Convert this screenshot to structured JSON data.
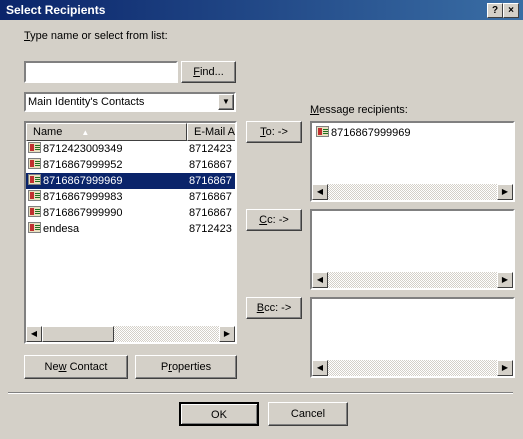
{
  "window": {
    "title": "Select Recipients",
    "help_label": "?",
    "close_label": "×"
  },
  "search": {
    "label": "Type name or select from list:",
    "value": "",
    "find_label": "Find..."
  },
  "source": {
    "selected": "Main Identity's Contacts"
  },
  "contacts": {
    "columns": [
      "Name",
      "E-Mail A"
    ],
    "rows": [
      {
        "name": "8712423009349",
        "email": "8712423"
      },
      {
        "name": "8716867999952",
        "email": "8716867"
      },
      {
        "name": "8716867999969",
        "email": "8716867",
        "selected": true
      },
      {
        "name": "8716867999983",
        "email": "8716867"
      },
      {
        "name": "8716867999990",
        "email": "8716867"
      },
      {
        "name": "endesa",
        "email": "8712423"
      }
    ]
  },
  "buttons": {
    "to": "To: ->",
    "cc": "Cc: ->",
    "bcc": "Bcc: ->",
    "new_contact": "New Contact",
    "properties": "Properties",
    "ok": "OK",
    "cancel": "Cancel"
  },
  "recipients": {
    "label": "Message recipients:",
    "to_items": [
      "8716867999969"
    ]
  },
  "icons": {
    "contact": "contact-card-icon",
    "sort": "sort-arrow-icon",
    "dropdown": "dropdown-arrow-icon"
  }
}
